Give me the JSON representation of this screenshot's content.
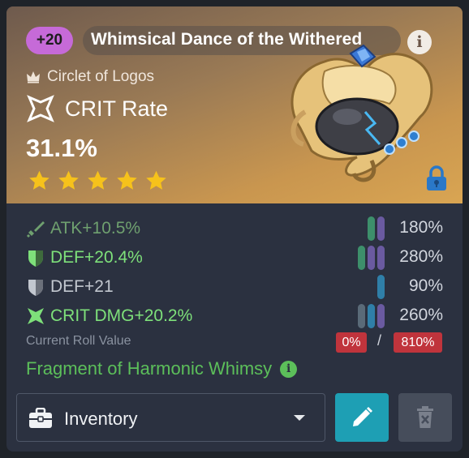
{
  "artifact": {
    "level": "+20",
    "set_name": "Whimsical Dance of the Withered",
    "slot": "Circlet of Logos",
    "main_stat": "CRIT Rate",
    "main_value": "31.1%",
    "rarity": 5
  },
  "substats": [
    {
      "label": "ATK+10.5%",
      "percent": "180%",
      "color": "#6fa06f",
      "icon": "sword-icon",
      "bars": [
        "#3d8f6b",
        "#6a5aa0"
      ]
    },
    {
      "label": "DEF+20.4%",
      "percent": "280%",
      "color": "#7ee07a",
      "icon": "shield-icon",
      "bars": [
        "#3d8f6b",
        "#6a5aa0",
        "#6a5aa0"
      ]
    },
    {
      "label": "DEF+21",
      "percent": "90%",
      "color": "#c2c7cf",
      "icon": "shield-icon",
      "bars": [
        "#2f7fa8"
      ]
    },
    {
      "label": "CRIT DMG+20.2%",
      "percent": "260%",
      "color": "#7ee07a",
      "icon": "crit-icon",
      "bars": [
        "#5a6a78",
        "#2f7fa8",
        "#6a5aa0"
      ]
    }
  ],
  "roll": {
    "label": "Current Roll Value",
    "current": "0%",
    "separator": "/",
    "max": "810%"
  },
  "fragment": {
    "name": "Fragment of Harmonic Whimsy"
  },
  "location": {
    "selected": "Inventory"
  },
  "colors": {
    "accent_edit": "#1e9fb4",
    "level_badge": "#c66ad8",
    "roll_badge": "#c0343c",
    "star": "#f6c21b",
    "lock": "#2a78c8"
  }
}
